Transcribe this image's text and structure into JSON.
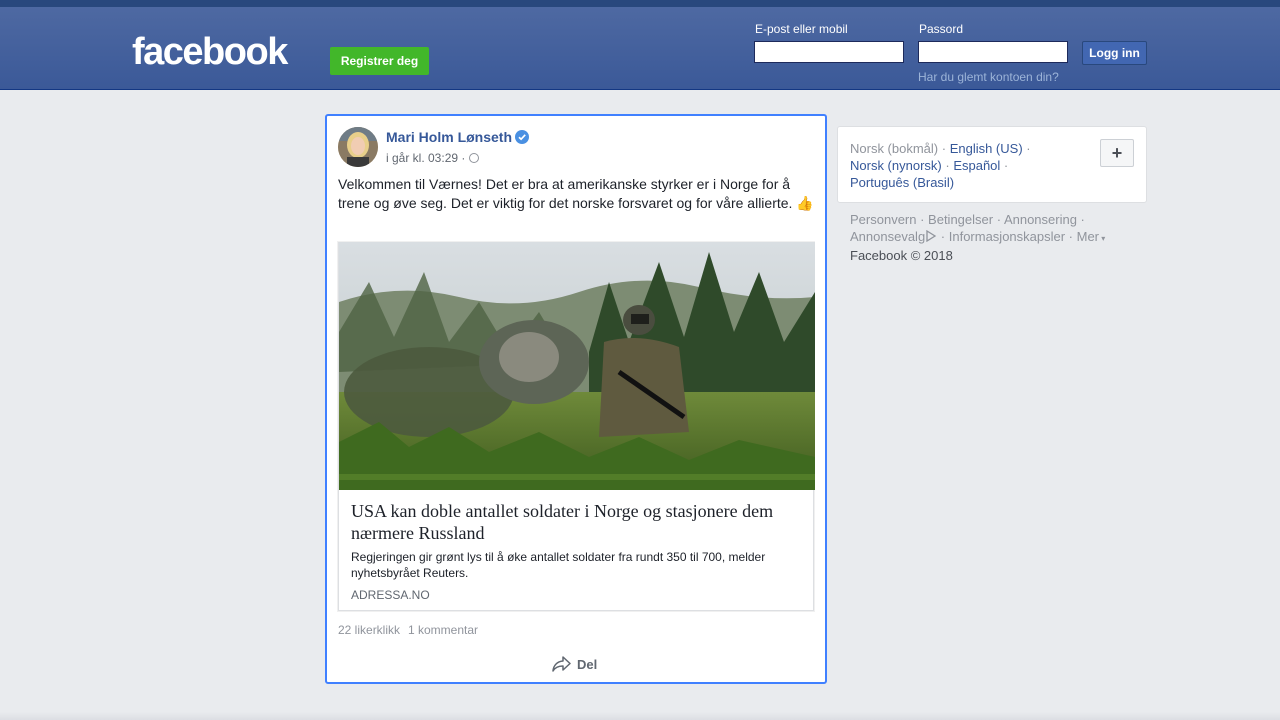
{
  "header": {
    "logo": "facebook",
    "register_label": "Registrer deg",
    "email_label": "E-post eller mobil",
    "password_label": "Passord",
    "login_label": "Logg inn",
    "forgot_label": "Har du glemt kontoen din?"
  },
  "post": {
    "author": "Mari Holm Lønseth",
    "time": "i går kl. 03:29 ·",
    "text": "Velkommen til Værnes! Det er bra at amerikanske styrker er i Norge for å trene og øve seg. Det er viktig for det norske forsvaret og for våre allierte.",
    "emoji": "👍",
    "link": {
      "title": "USA kan doble antallet soldater i Norge og stasjonere dem nærmere Russland",
      "description": "Regjeringen gir grønt lys til å øke antallet soldater fra rundt 350 til 700, melder nyhetsbyrået Reuters.",
      "domain": "ADRESSA.NO"
    },
    "likes": "22 likerklikk",
    "comments": "1 kommentar",
    "share_label": "Del"
  },
  "languages": {
    "current": "Norsk (bokmål)",
    "items": [
      "English (US)",
      "Norsk (nynorsk)",
      "Español",
      "Português (Brasil)"
    ],
    "add_label": "+"
  },
  "footer": {
    "links": [
      "Personvern",
      "Betingelser",
      "Annonsering",
      "Annonsevalg",
      "Informasjonskapsler",
      "Mer"
    ],
    "copyright": "Facebook © 2018"
  },
  "colors": {
    "header": "#3b5998",
    "link": "#365899",
    "register": "#42b72a",
    "focus_border": "#4080ff"
  }
}
